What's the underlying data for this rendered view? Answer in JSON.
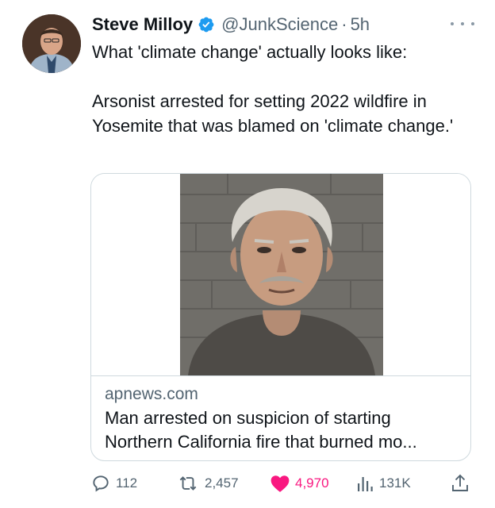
{
  "tweet": {
    "author_name": "Steve Milloy",
    "handle": "@JunkScience",
    "separator": "·",
    "time": "5h",
    "text_line_1": "What 'climate change' actually looks like:",
    "text_line_2": "Arsonist arrested for setting 2022 wildfire in Yosemite that was blamed on 'climate change.'"
  },
  "card": {
    "domain": "apnews.com",
    "title": "Man arrested on suspicion of starting Northern California fire that burned mo..."
  },
  "actions": {
    "replies": "112",
    "reposts": "2,457",
    "likes": "4,970",
    "views": "131K"
  },
  "colors": {
    "accent": "#1d9bf0",
    "like": "#f91880",
    "muted": "#536471",
    "text": "#0f1419"
  },
  "icons": {
    "verified": "verified-badge-icon",
    "more": "more-horizontal-icon",
    "reply": "reply-icon",
    "repost": "repost-icon",
    "like": "heart-icon",
    "views": "views-chart-icon",
    "share": "share-icon"
  }
}
